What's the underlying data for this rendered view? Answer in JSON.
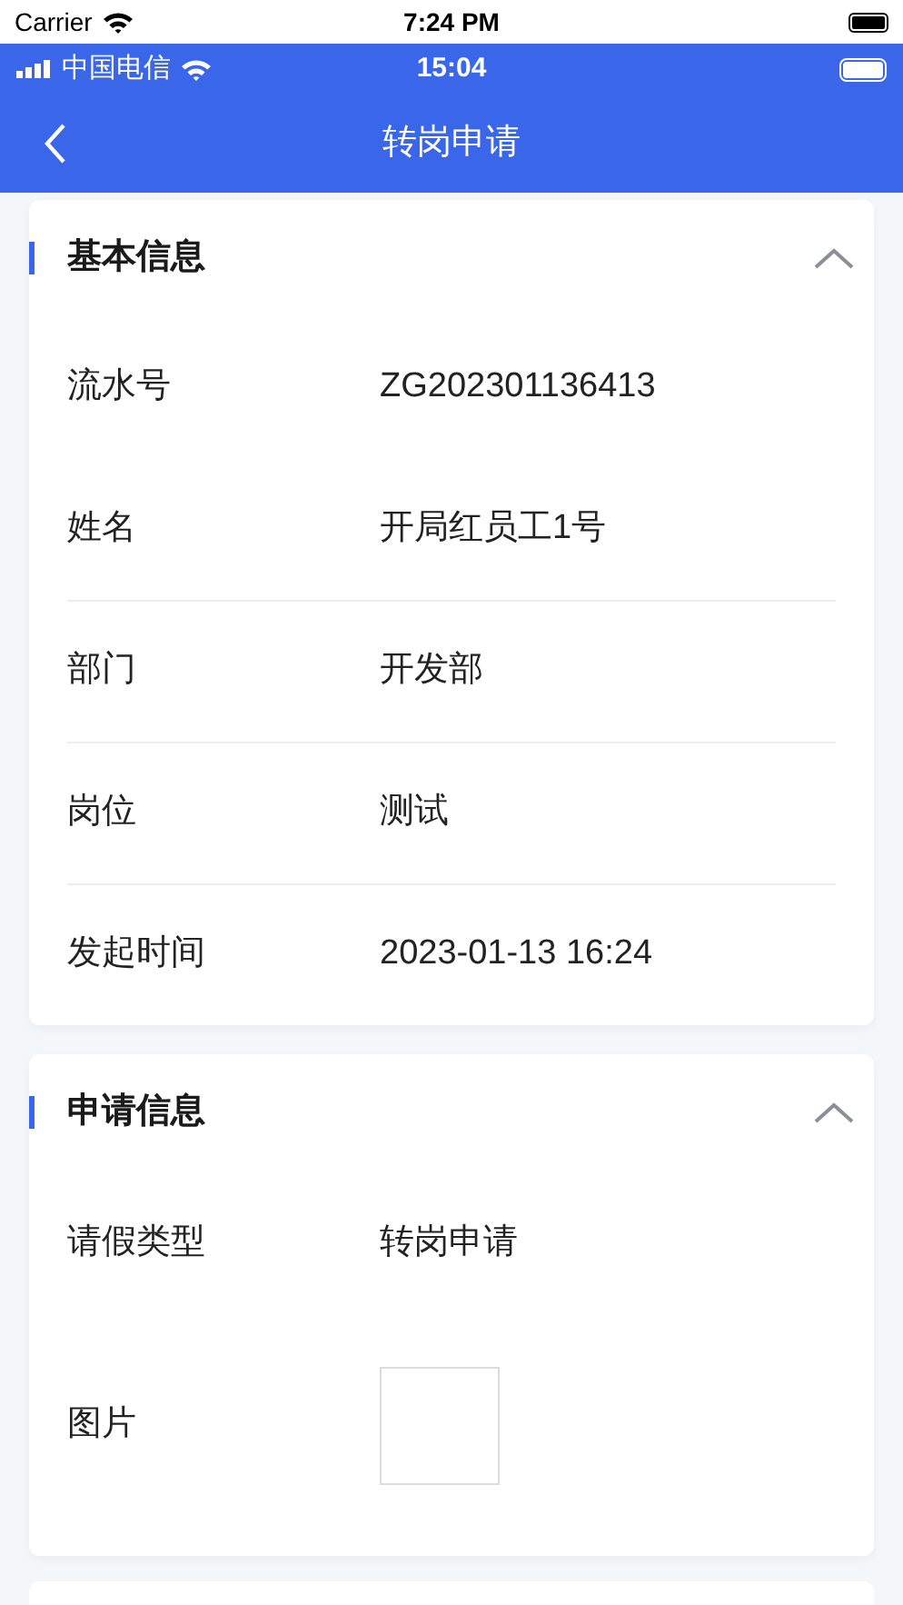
{
  "device_status": {
    "carrier": "Carrier",
    "time": "7:24 PM"
  },
  "app_status": {
    "carrier": "中国电信",
    "time": "15:04"
  },
  "nav": {
    "title": "转岗申请"
  },
  "sections": [
    {
      "title": "基本信息",
      "expanded": true,
      "rows": [
        {
          "kind": "text",
          "label": "流水号",
          "value": "ZG202301136413",
          "divider_above": false
        },
        {
          "kind": "text",
          "label": "姓名",
          "value": "开局红员工1号",
          "divider_above": false
        },
        {
          "kind": "text",
          "label": "部门",
          "value": "开发部",
          "divider_above": true
        },
        {
          "kind": "text",
          "label": "岗位",
          "value": "测试",
          "divider_above": true
        },
        {
          "kind": "text",
          "label": "发起时间",
          "value": "2023-01-13 16:24",
          "divider_above": true
        }
      ]
    },
    {
      "title": "申请信息",
      "expanded": true,
      "rows": [
        {
          "kind": "text",
          "label": "请假类型",
          "value": "转岗申请",
          "divider_above": false
        },
        {
          "kind": "image",
          "label": "图片",
          "divider_above": false
        }
      ]
    }
  ]
}
